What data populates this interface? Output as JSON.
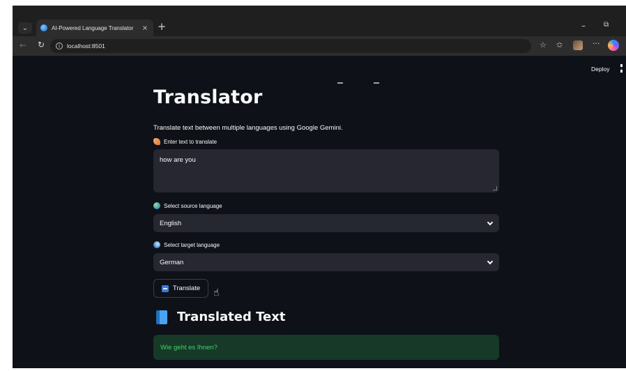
{
  "browser": {
    "tab_title": "AI-Powered Language Translator",
    "tab_close": "×",
    "new_tab": "+",
    "url": "localhost:8501",
    "minimize": "–",
    "restore": "⧉",
    "more": "···",
    "icons": [
      "tab-menu-icon",
      "favicon",
      "back-icon",
      "reload-icon",
      "info-icon",
      "star-icon",
      "favorites-icon",
      "profile-avatar",
      "more-icon",
      "copilot-icon"
    ]
  },
  "app": {
    "deploy_label": "Deploy",
    "title": "Translator",
    "subtitle": "Translate text between multiple languages using Google Gemini.",
    "input_label": "Enter text to translate",
    "input_value": "how are you",
    "source_label": "Select source language",
    "source_value": "English",
    "target_label": "Select target language",
    "target_value": "German",
    "translate_button": "Translate",
    "result_heading": "Translated Text",
    "result_text": "Wie geht es Ihnen?",
    "colors": {
      "background": "#0e1117",
      "input_bg": "#262730",
      "text": "#fafafa",
      "success_bg": "#173928",
      "success_text": "#3dd56d"
    }
  }
}
